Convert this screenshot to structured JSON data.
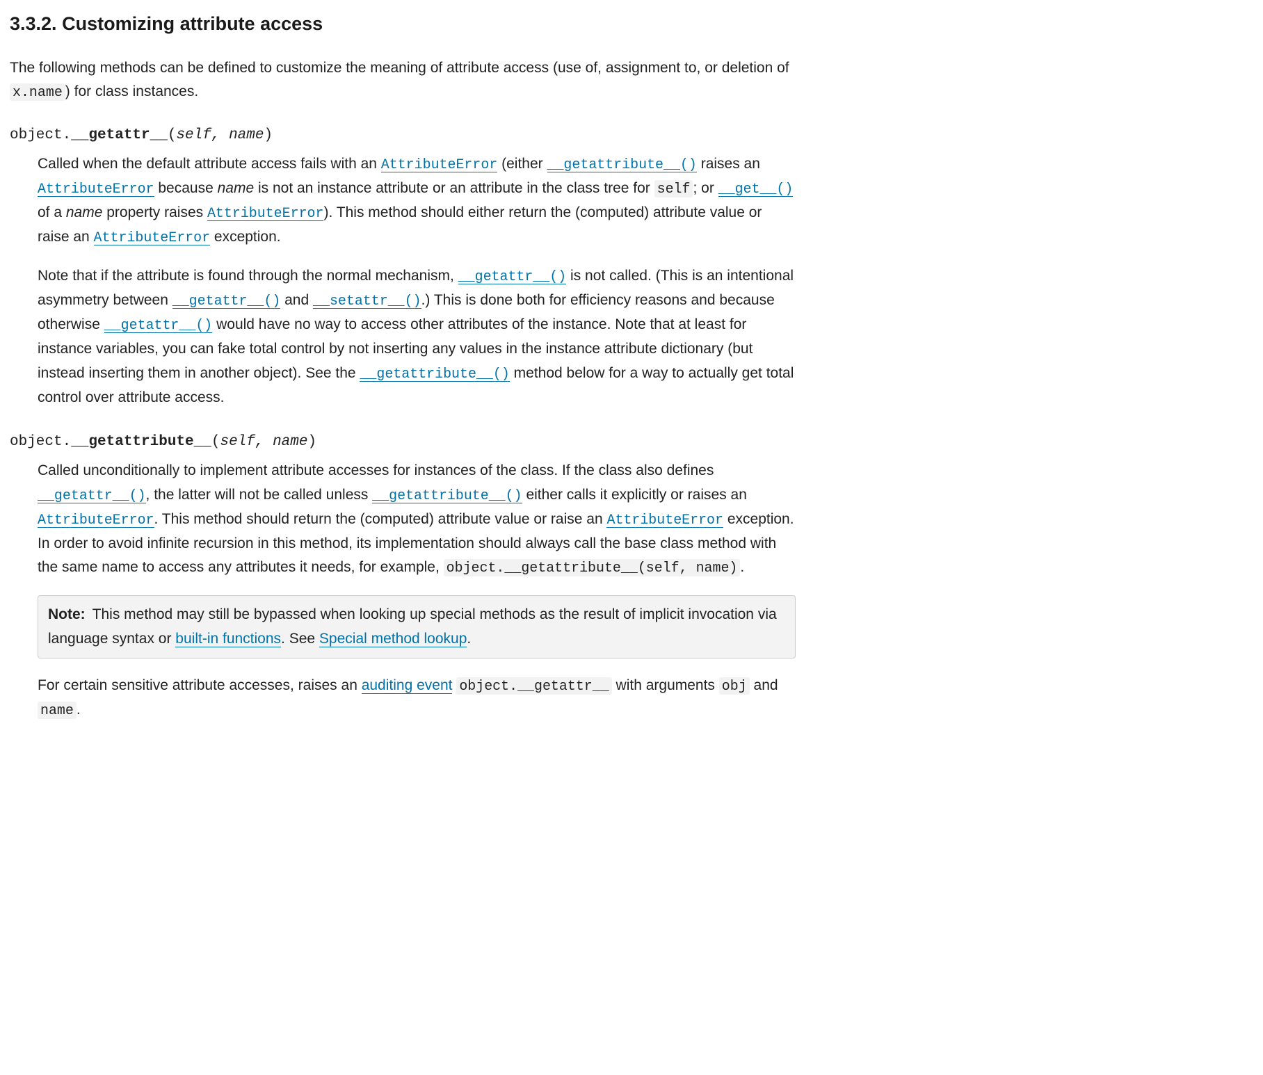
{
  "section": {
    "number": "3.3.2.",
    "title": "Customizing attribute access"
  },
  "intro": {
    "p1a": "The following methods can be defined to customize the meaning of attribute access (use of, assignment to, or deletion of ",
    "code_xname": "x.name",
    "p1b": ") for class instances."
  },
  "getattr": {
    "classname": "object.",
    "method": "__getattr__",
    "params_open": "(",
    "params": "self, name",
    "params_close": ")",
    "p1": {
      "t1": "Called when the default attribute access fails with an ",
      "l1": "AttributeError",
      "t2": " (either ",
      "l2": "__getattribute__()",
      "t3": " raises an ",
      "l3": "AttributeError",
      "t4": " because ",
      "i1": "name",
      "t5": " is not an instance attribute or an attribute in the class tree for ",
      "c1": "self",
      "t6": "; or ",
      "l4": "__get__()",
      "t7": " of a ",
      "i2": "name",
      "t8": " property raises ",
      "l5": "AttributeError",
      "t9": "). This method should either return the (computed) attribute value or raise an ",
      "l6": "AttributeError",
      "t10": " exception."
    },
    "p2": {
      "t1": "Note that if the attribute is found through the normal mechanism, ",
      "l1": "__getattr__()",
      "t2": " is not called. (This is an intentional asymmetry between ",
      "l2": "__getattr__()",
      "t3": " and ",
      "l3": "__setattr__()",
      "t4": ".) This is done both for efficiency reasons and because otherwise ",
      "l4": "__getattr__()",
      "t5": " would have no way to access other attributes of the instance. Note that at least for instance variables, you can fake total control by not inserting any values in the instance attribute dictionary (but instead inserting them in another object). See the ",
      "l5": "__getattribute__()",
      "t6": " method below for a way to actually get total control over attribute access."
    }
  },
  "getattribute": {
    "classname": "object.",
    "method": "__getattribute__",
    "params_open": "(",
    "params": "self, name",
    "params_close": ")",
    "p1": {
      "t1": "Called unconditionally to implement attribute accesses for instances of the class. If the class also defines ",
      "l1": "__getattr__()",
      "t2": ", the latter will not be called unless ",
      "l2": "__getattribute__()",
      "t3": " either calls it explicitly or raises an ",
      "l3": "AttributeError",
      "t4": ". This method should return the (computed) attribute value or raise an ",
      "l4": "AttributeError",
      "t5": " exception. In order to avoid infinite recursion in this method, its implementation should always call the base class method with the same name to access any attributes it needs, for example, ",
      "c1": "object.__getattribute__(self, name)",
      "t6": "."
    },
    "note": {
      "label": "Note:",
      "t1": "This method may still be bypassed when looking up special methods as the result of implicit invocation via language syntax or ",
      "l1": "built-in functions",
      "t2": ". See ",
      "l2": "Special method lookup",
      "t3": "."
    },
    "p2": {
      "t1": "For certain sensitive attribute accesses, raises an ",
      "l1": "auditing event",
      "t2": " ",
      "c1": "object.__getattr__",
      "t3": " with arguments ",
      "c2": "obj",
      "t4": " and ",
      "c3": "name",
      "t5": "."
    }
  }
}
